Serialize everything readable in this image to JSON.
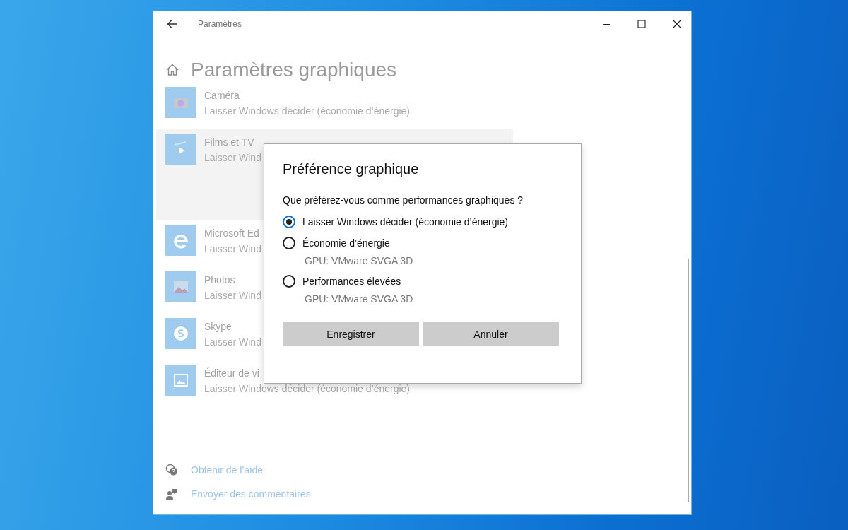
{
  "window": {
    "title": "Paramètres",
    "page_title": "Paramètres graphiques",
    "apps": [
      {
        "name": "Caméra",
        "preference": "Laisser Windows décider (économie d’énergie)",
        "selected": false,
        "kind": "camera"
      },
      {
        "name": "Films et TV",
        "preference": "Laisser Wind",
        "selected": true,
        "kind": "film"
      },
      {
        "name": "Microsoft Ed",
        "preference": "Laisser Wind",
        "selected": false,
        "kind": "browser"
      },
      {
        "name": "Photos",
        "preference": "Laisser Wind",
        "selected": false,
        "kind": "photo"
      },
      {
        "name": "Skype",
        "preference": "Laisser Wind",
        "selected": false,
        "kind": "chat"
      },
      {
        "name": "Éditeur de vi",
        "preference": "Laisser Windows décider (économie d’énergie)",
        "selected": false,
        "kind": "video"
      }
    ],
    "links": [
      {
        "label": "Obtenir de l’aide",
        "kind": "help"
      },
      {
        "label": "Envoyer des commentaires",
        "kind": "feedback"
      }
    ]
  },
  "dialog": {
    "title": "Préférence graphique",
    "question": "Que préférez-vous comme performances graphiques ?",
    "options": [
      {
        "label": "Laisser Windows décider (économie d’énergie)",
        "selected": true
      },
      {
        "label": "Économie d’énergie",
        "detail": "GPU: VMware SVGA 3D",
        "selected": false
      },
      {
        "label": "Performances élevées",
        "detail": "GPU: VMware SVGA 3D",
        "selected": false
      }
    ],
    "buttons": [
      "Enregistrer",
      "Annuler"
    ]
  }
}
